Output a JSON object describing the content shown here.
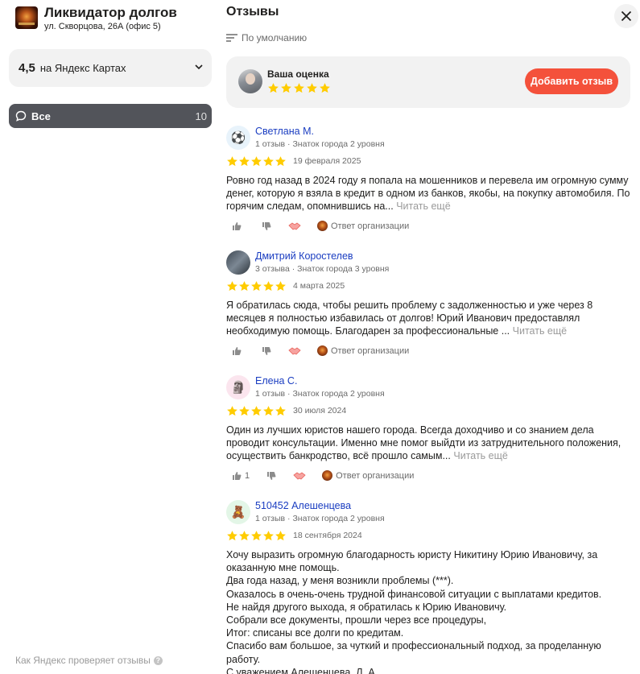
{
  "org": {
    "name": "Ликвидатор долгов",
    "address": "ул. Скворцова, 26А (офис 5)"
  },
  "rating": {
    "value": "4,5",
    "source": "на Яндекс Картах"
  },
  "filter": {
    "all_label": "Все",
    "all_count": "10"
  },
  "footer": {
    "how_checks": "Как Яндекс проверяет отзывы"
  },
  "reviews_panel": {
    "title": "Отзывы",
    "sort_label": "По умолчанию",
    "your_rating_label": "Ваша оценка",
    "add_review_button": "Добавить отзыв",
    "read_more": "Читать ещё",
    "org_reply": "Ответ организации"
  },
  "colors": {
    "accent": "#f4513b",
    "star": "#fc0",
    "name_link": "#1a3dc1",
    "filter_bg": "#52545a"
  },
  "reviews": [
    {
      "name": "Светлана М.",
      "meta": "1 отзыв · Знаток города 2 уровня",
      "stars": 5,
      "date": "19 февраля 2025",
      "avatar_icon": "soccer-ball-icon",
      "text": "Ровно год назад в 2024 году я попала на мошенников и перевела им огромную сумму денег, которую я взяла в кредит в одном из банков, якобы, на покупку автомобиля. По горячим следам, опомнившись на...",
      "likes": ""
    },
    {
      "name": "Дмитрий Коростелев",
      "meta": "3 отзыва · Знаток города 3 уровня",
      "stars": 5,
      "date": "4 марта 2025",
      "avatar_icon": "car-photo-icon",
      "text": "Я обратилась сюда, чтобы решить проблему с задолженностью и уже через 8 месяцев я полностью избавилась от долгов! Юрий Иванович предоставлял необходимую помощь. Благодарен за профессиональные ...",
      "likes": ""
    },
    {
      "name": "Елена С.",
      "meta": "1 отзыв · Знаток города 2 уровня",
      "stars": 5,
      "date": "30 июля 2024",
      "avatar_icon": "statue-icon",
      "text": "Один из лучших юристов нашего города. Всегда доходчиво и со знанием дела проводит консультации. Именно мне помог выйдти из затруднительного положения, осуществить банкродство, всё прошло самым...",
      "likes": "1"
    },
    {
      "name": "510452 Алешенцева",
      "meta": "1 отзыв · Знаток города 2 уровня",
      "stars": 5,
      "date": "18 сентября 2024",
      "avatar_icon": "toy-icon",
      "text": "Хочу выразить огромную благодарность юристу Никитину Юрию Ивановичу, за оказанную мне помощь.\nДва года назад, у меня возникли проблемы (***).\nОказалось в очень-очень трудной финансовой ситуации с выплатами кредитов.\nНе найдя другого выхода, я обратилась к Юрию Ивановичу.\nСобрали все документы, прошли через все процедуры,\nИтог: списаны все долги по кредитам.\nСпасибо вам большое, за чуткий и профессиональный подход, за проделанную работу.\nС уважением Алешенцева. Л. А.",
      "likes": ""
    }
  ]
}
